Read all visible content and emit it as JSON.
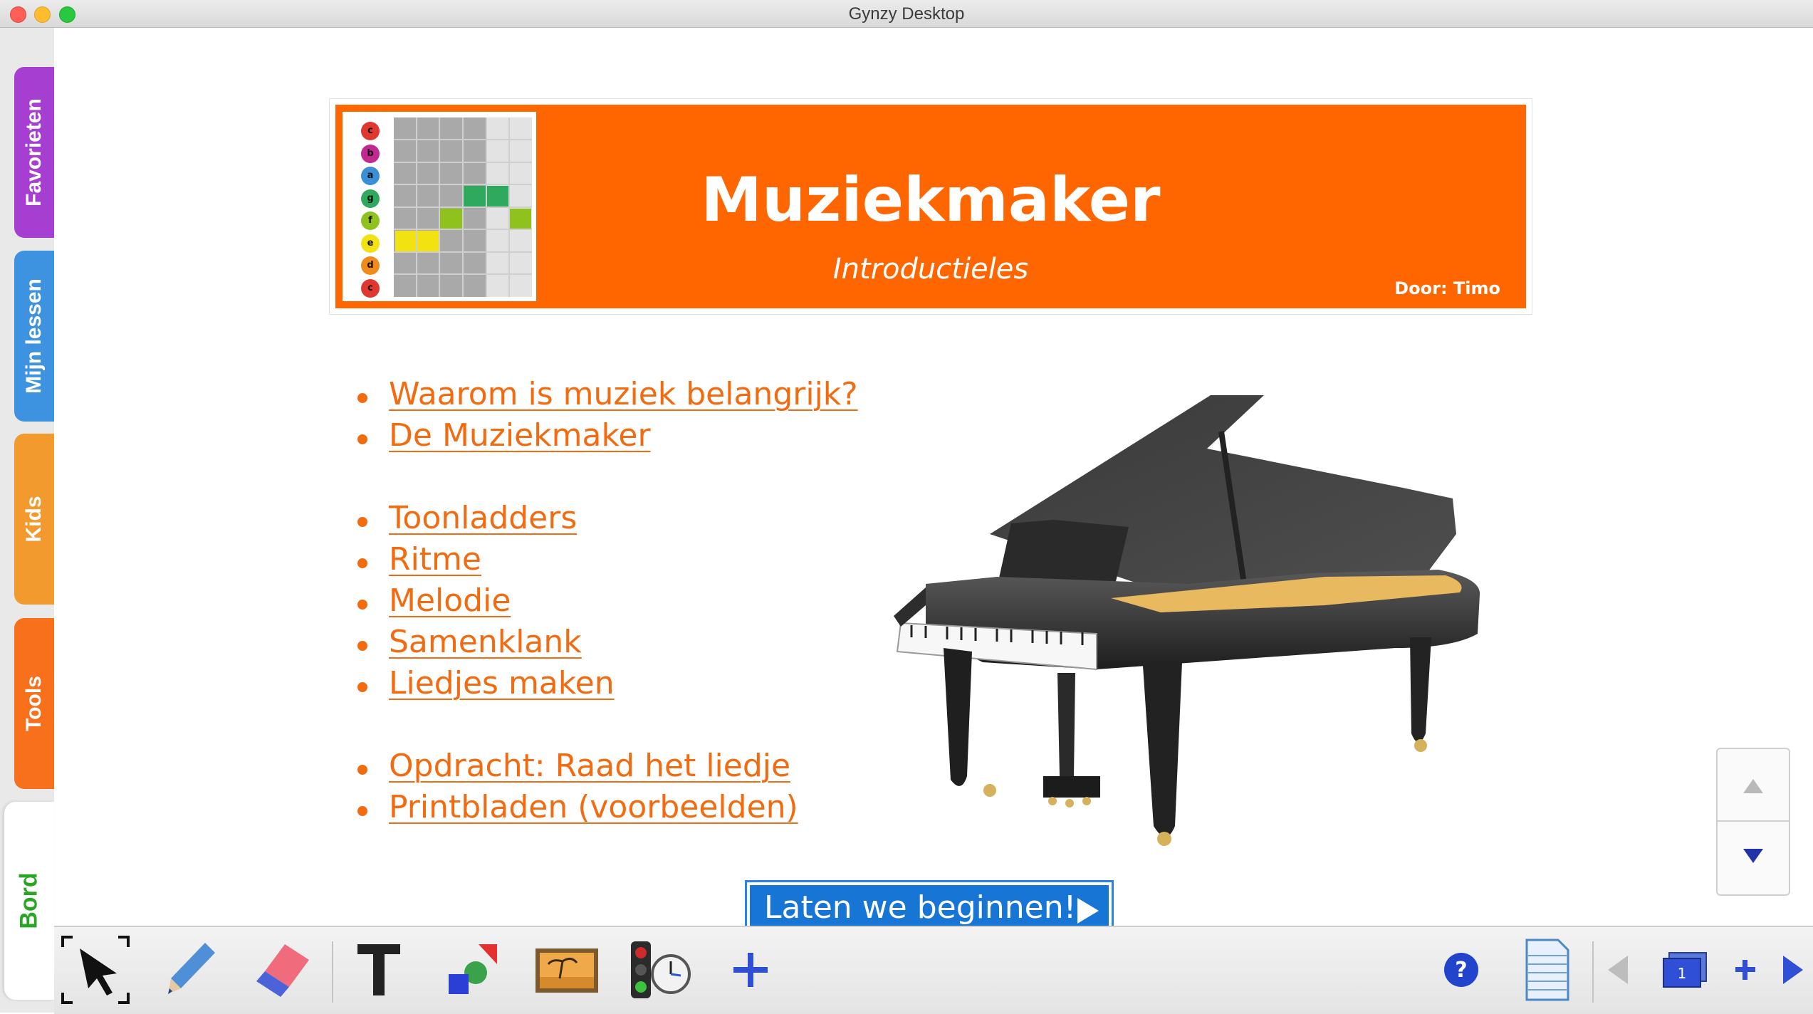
{
  "window": {
    "title": "Gynzy Desktop"
  },
  "sidebar": {
    "tabs": [
      {
        "label": "Favorieten",
        "color": "#a63fd1"
      },
      {
        "label": "Mijn lessen",
        "color": "#3d93e0"
      },
      {
        "label": "Kids",
        "color": "#f39a2f"
      },
      {
        "label": "Tools",
        "color": "#f8701b"
      },
      {
        "label": "Bord",
        "color": "#2aa526",
        "active": true
      }
    ]
  },
  "banner": {
    "title": "Muziekmaker",
    "subtitle": "Introductieles",
    "author": "Door: Timo",
    "color": "#ff6600",
    "thumbnail_notes": [
      "c",
      "b",
      "a",
      "g",
      "f",
      "e",
      "d",
      "c"
    ]
  },
  "menu": {
    "groups": [
      [
        "Waarom is muziek belangrijk?",
        "De Muziekmaker"
      ],
      [
        "Toonladders",
        "Ritme",
        "Melodie",
        "Samenklank",
        "Liedjes maken"
      ],
      [
        "Opdracht: Raad het liedje",
        " Printbladen (voorbeelden)"
      ]
    ],
    "link_color": "#f26b10"
  },
  "start_button": {
    "label": "Laten we beginnen!",
    "color": "#1775d6"
  },
  "toolbar": {
    "tools": [
      "select-arrow-icon",
      "pen-icon",
      "eraser-icon",
      "text-tool-icon",
      "shapes-icon",
      "image-icon",
      "traffic-light-timer-icon",
      "add-tool-icon"
    ],
    "right": [
      "help-icon",
      "page-overview-icon",
      "previous-page-icon",
      "page-thumbnail-icon",
      "add-page-icon",
      "next-page-icon"
    ],
    "current_page": "1"
  }
}
